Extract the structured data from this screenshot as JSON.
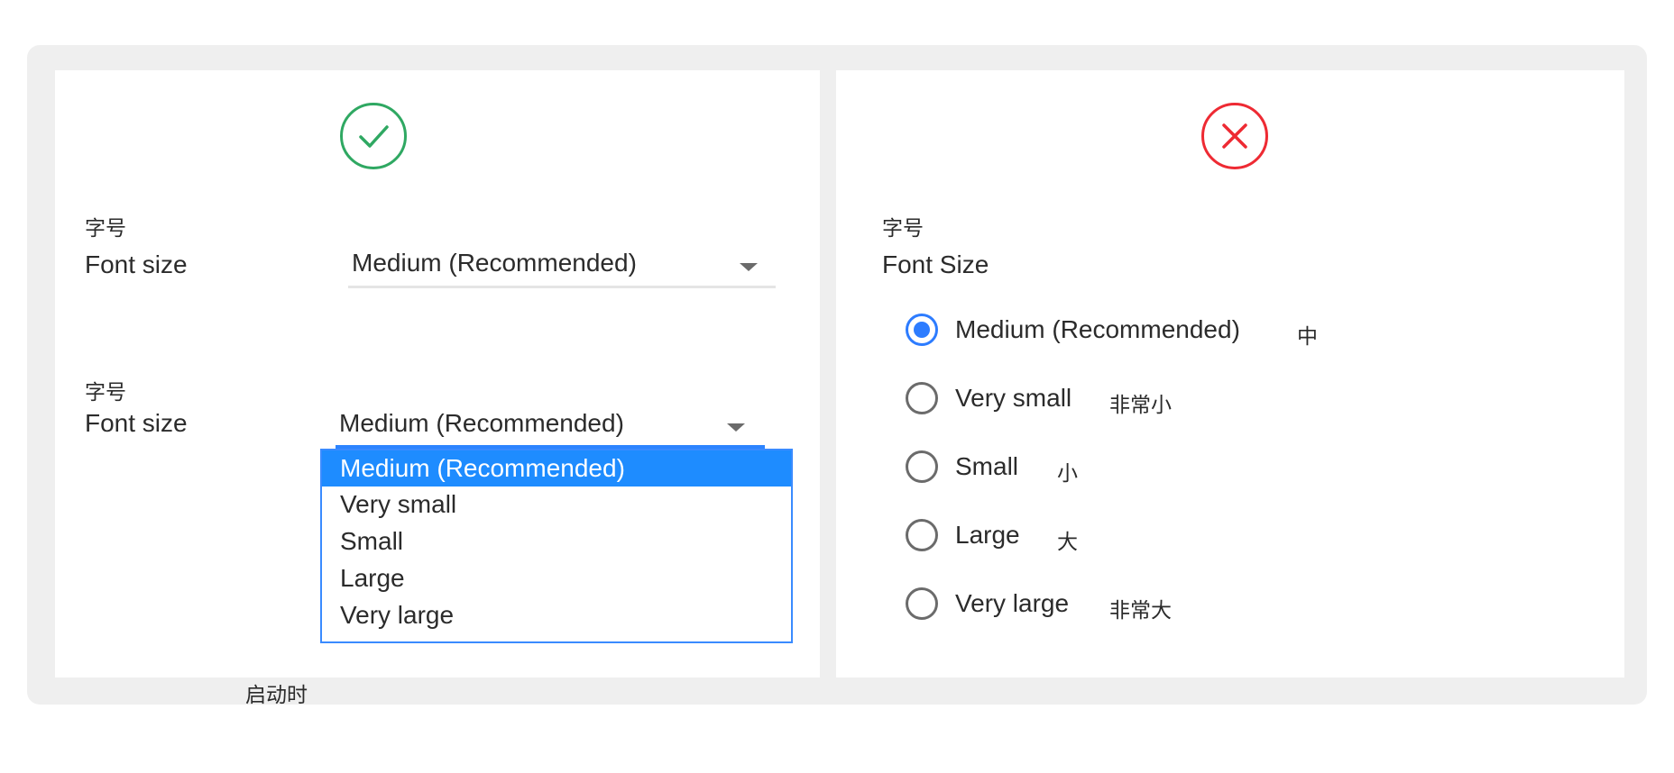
{
  "colors": {
    "frame_bg": "#efefef",
    "panel_bg": "#ffffff",
    "correct": "#2fa862",
    "incorrect": "#ee2a33",
    "accent": "#1e8cff"
  },
  "good_example": {
    "badge_icon": "check-circle-icon",
    "closed": {
      "label_cjk": "字号",
      "label": "Font size",
      "value": "Medium (Recommended)",
      "caret_icon": "chevron-down-icon"
    },
    "opened": {
      "label_cjk": "字号",
      "label": "Font size",
      "value": "Medium (Recommended)",
      "caret_icon": "chevron-down-icon",
      "options": [
        "Medium (Recommended)",
        "Very small",
        "Small",
        "Large",
        "Very large"
      ],
      "selected_index": 0
    },
    "below_text": "启动时"
  },
  "bad_example": {
    "badge_icon": "x-circle-icon",
    "label_cjk": "字号",
    "label": "Font Size",
    "options": [
      {
        "label": "Medium (Recommended)",
        "cjk": "中",
        "checked": true
      },
      {
        "label": "Very small",
        "cjk": "非常小",
        "checked": false
      },
      {
        "label": "Small",
        "cjk": "小",
        "checked": false
      },
      {
        "label": "Large",
        "cjk": "大",
        "checked": false
      },
      {
        "label": "Very large",
        "cjk": "非常大",
        "checked": false
      }
    ]
  }
}
